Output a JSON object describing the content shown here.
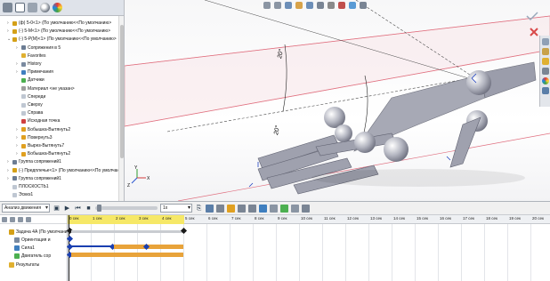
{
  "tree": {
    "items": [
      {
        "label": "(ф) 5-0<1> (По умолчанию<<По умолчанию>",
        "color": "#d4a017",
        "indent": 0,
        "expander": "+"
      },
      {
        "label": "(-) 5-М<1> (По умолчанию<<По умолчанию>",
        "color": "#d4a017",
        "indent": 0,
        "expander": "+"
      },
      {
        "label": "(-) 5-Р(М)<1> (По умолчанию<<По умолчанию>",
        "color": "#d4a017",
        "indent": 0,
        "expander": "-"
      },
      {
        "label": "Сопряжения в 5",
        "color": "#6b7c93",
        "indent": 1,
        "expander": "+"
      },
      {
        "label": "Favorites",
        "color": "#e0b030",
        "indent": 1,
        "expander": ""
      },
      {
        "label": "History",
        "color": "#7a8aa0",
        "indent": 1,
        "expander": "+"
      },
      {
        "label": "Примечания",
        "color": "#3f7fbf",
        "indent": 1,
        "expander": "+"
      },
      {
        "label": "Датчики",
        "color": "#4caf50",
        "indent": 1,
        "expander": ""
      },
      {
        "label": "Материал <не указан>",
        "color": "#9e9e9e",
        "indent": 1,
        "expander": ""
      },
      {
        "label": "Спереди",
        "color": "#bfc7d2",
        "indent": 1,
        "expander": ""
      },
      {
        "label": "Сверху",
        "color": "#bfc7d2",
        "indent": 1,
        "expander": ""
      },
      {
        "label": "Справа",
        "color": "#bfc7d2",
        "indent": 1,
        "expander": ""
      },
      {
        "label": "Исходная точка",
        "color": "#d04040",
        "indent": 1,
        "expander": ""
      },
      {
        "label": "Бобышка-Вытянуть2",
        "color": "#e0a020",
        "indent": 1,
        "expander": "+"
      },
      {
        "label": "Повернуть3",
        "color": "#e0a020",
        "indent": 1,
        "expander": "+"
      },
      {
        "label": "Вырез-Вытянуть7",
        "color": "#e0a020",
        "indent": 1,
        "expander": "+"
      },
      {
        "label": "Бобышка-Вытянуть2",
        "color": "#e0a020",
        "indent": 1,
        "expander": "+"
      },
      {
        "label": "Группа сопряжений1",
        "color": "#6b7c93",
        "indent": 0,
        "expander": "+"
      },
      {
        "label": "(-) Предплечье<1> (По умолчанию<<По умолчани",
        "color": "#d4a017",
        "indent": 0,
        "expander": "+"
      },
      {
        "label": "Группа сопряжений1",
        "color": "#6b7c93",
        "indent": 0,
        "expander": "+"
      },
      {
        "label": "ПЛОСКОСТЬ1",
        "color": "#bfc7d2",
        "indent": 0,
        "expander": ""
      },
      {
        "label": "Эскиз1",
        "color": "#bfc7d2",
        "indent": 0,
        "expander": ""
      }
    ]
  },
  "viewport": {
    "dimension_1": "20°",
    "dimension_2": "20°",
    "triad_labels": [
      "Y",
      "X",
      "Z"
    ]
  },
  "motion": {
    "study_type": "Анализ движения",
    "playback_speed": "1x",
    "tree_items": [
      {
        "label": "Задача 4А (По умолчани",
        "color": "#d4a017"
      },
      {
        "label": "Ориентация и",
        "color": "#7a8aa0"
      },
      {
        "label": "Сила1",
        "color": "#3f7fbf"
      },
      {
        "label": "Двигатель сор",
        "color": "#4caf50"
      },
      {
        "label": "Результаты",
        "color": "#e0b030"
      }
    ],
    "ticks": [
      "0 сек",
      "1 сек",
      "2 сек",
      "3 сек",
      "4 сек",
      "5 сек",
      "6 сек",
      "7 сек",
      "8 сек",
      "9 сек",
      "10 сек",
      "11 сек",
      "12 сек",
      "13 сек",
      "14 сек",
      "15 сек",
      "16 сек",
      "17 сек",
      "18 сек",
      "19 сек",
      "20 сек"
    ]
  },
  "colors": {
    "key_blue": "#1a3fb0",
    "bar_orange": "#e8a33a",
    "ruler_yellow": "#f6e867",
    "plane_red": "#e0606a"
  }
}
